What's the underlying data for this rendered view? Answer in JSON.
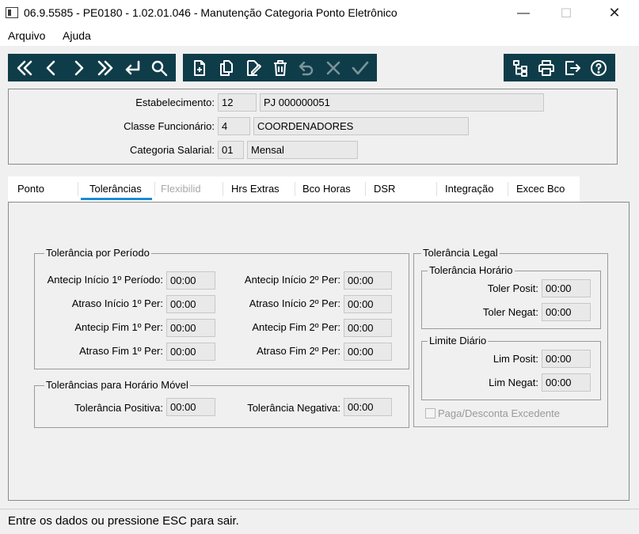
{
  "window": {
    "title": "06.9.5585 - PE0180 - 1.02.01.046 - Manutenção Categoria Ponto Eletrônico",
    "minimize": "—",
    "maximize": "☐",
    "close": "✕"
  },
  "menu": {
    "file": "Arquivo",
    "help": "Ajuda"
  },
  "toolbar": {
    "bg_color": "#0f3c49",
    "nav_icons": [
      "first-icon",
      "previous-icon",
      "next-icon",
      "last-icon",
      "goto-icon",
      "search-icon"
    ],
    "edit_icons": [
      "add-icon",
      "copy-icon",
      "edit-icon",
      "delete-icon",
      "undo-icon",
      "cancel-icon",
      "save-icon"
    ],
    "misc_icons": [
      "hierarchy-icon",
      "print-icon",
      "exit-icon",
      "help-icon"
    ]
  },
  "header": {
    "estabelecimento_label": "Estabelecimento:",
    "estabelecimento_code": "12",
    "estabelecimento_name": "PJ 000000051",
    "classe_label": "Classe Funcionário:",
    "classe_code": "4",
    "classe_name": "COORDENADORES",
    "categoria_label": "Categoria Salarial:",
    "categoria_code": "01",
    "categoria_name": "Mensal"
  },
  "tabs": [
    {
      "label": "Ponto"
    },
    {
      "label": "Tolerâncias"
    },
    {
      "label": "Flexibilid"
    },
    {
      "label": "Hrs Extras"
    },
    {
      "label": "Bco Horas"
    },
    {
      "label": "DSR"
    },
    {
      "label": "Integração"
    },
    {
      "label": "Excec Bco"
    }
  ],
  "active_tab_color": "#1a8bd6",
  "periodo": {
    "title": "Tolerância por Período",
    "antecip_inicio_1_label": "Antecip Início 1º Período:",
    "antecip_inicio_1": "00:00",
    "atraso_inicio_1_label": "Atraso Início 1º Per:",
    "atraso_inicio_1": "00:00",
    "antecip_fim_1_label": "Antecip Fim 1º Per:",
    "antecip_fim_1": "00:00",
    "atraso_fim_1_label": "Atraso Fim 1º Per:",
    "atraso_fim_1": "00:00",
    "antecip_inicio_2_label": "Antecip Início 2º Per:",
    "antecip_inicio_2": "00:00",
    "atraso_inicio_2_label": "Atraso Início 2º Per:",
    "atraso_inicio_2": "00:00",
    "antecip_fim_2_label": "Antecip Fim 2º Per:",
    "antecip_fim_2": "00:00",
    "atraso_fim_2_label": "Atraso Fim 2º Per:",
    "atraso_fim_2": "00:00"
  },
  "movel": {
    "title": "Tolerâncias para Horário Móvel",
    "positiva_label": "Tolerância Positiva:",
    "positiva": "00:00",
    "negativa_label": "Tolerância Negativa:",
    "negativa": "00:00"
  },
  "legal": {
    "title": "Tolerância Legal",
    "horario_title": "Tolerância Horário",
    "toler_posit_label": "Toler Posit:",
    "toler_posit": "00:00",
    "toler_negat_label": "Toler Negat:",
    "toler_negat": "00:00",
    "limite_title": "Limite Diário",
    "lim_posit_label": "Lim Posit:",
    "lim_posit": "00:00",
    "lim_negat_label": "Lim Negat:",
    "lim_negat": "00:00",
    "paga_label": "Paga/Desconta Excedente"
  },
  "status": "Entre os dados ou pressione ESC para sair."
}
